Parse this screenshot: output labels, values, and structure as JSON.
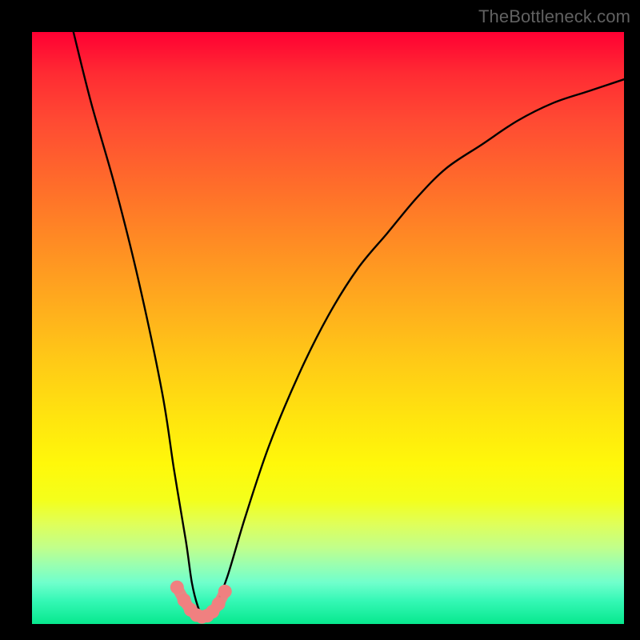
{
  "watermark": "TheBottleneck.com",
  "chart_data": {
    "type": "line",
    "title": "",
    "xlabel": "",
    "ylabel": "",
    "xlim": [
      0,
      100
    ],
    "ylim": [
      0,
      100
    ],
    "series": [
      {
        "name": "bottleneck-curve",
        "x": [
          7,
          10,
          14,
          18,
          22,
          24,
          26,
          27,
          28,
          29,
          30,
          31,
          33,
          36,
          40,
          45,
          50,
          55,
          60,
          65,
          70,
          76,
          82,
          88,
          94,
          100
        ],
        "values": [
          100,
          88,
          74,
          58,
          39,
          26,
          14,
          7,
          3,
          1,
          1,
          3,
          8,
          18,
          30,
          42,
          52,
          60,
          66,
          72,
          77,
          81,
          85,
          88,
          90,
          92
        ]
      },
      {
        "name": "highlight-dots",
        "x": [
          24.5,
          25.7,
          26.8,
          27.8,
          28.7,
          29.6,
          30.5,
          31.5,
          32.6
        ],
        "values": [
          6.2,
          4.0,
          2.4,
          1.5,
          1.2,
          1.4,
          2.1,
          3.4,
          5.5
        ]
      }
    ],
    "colors": {
      "curve": "#000000",
      "dots": "#f08080"
    }
  }
}
